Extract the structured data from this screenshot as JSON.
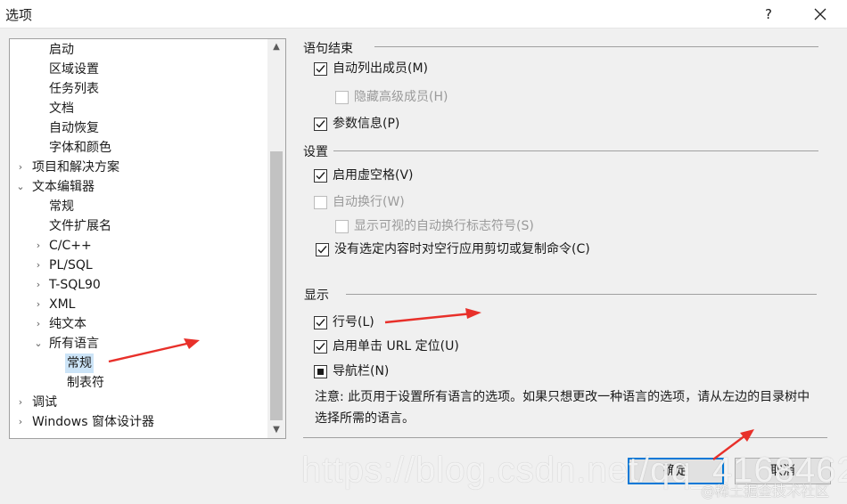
{
  "window": {
    "title": "选项",
    "help_label": "?"
  },
  "tree": {
    "items": [
      {
        "label": "启动",
        "expander": ""
      },
      {
        "label": "区域设置",
        "expander": ""
      },
      {
        "label": "任务列表",
        "expander": ""
      },
      {
        "label": "文档",
        "expander": ""
      },
      {
        "label": "自动恢复",
        "expander": ""
      },
      {
        "label": "字体和颜色",
        "expander": ""
      },
      {
        "label": "项目和解决方案",
        "expander": "›"
      },
      {
        "label": "文本编辑器",
        "expander": "⌄"
      },
      {
        "label": "常规",
        "expander": ""
      },
      {
        "label": "文件扩展名",
        "expander": ""
      },
      {
        "label": "C/C++",
        "expander": "›"
      },
      {
        "label": "PL/SQL",
        "expander": "›"
      },
      {
        "label": "T-SQL90",
        "expander": "›"
      },
      {
        "label": "XML",
        "expander": "›"
      },
      {
        "label": "纯文本",
        "expander": "›"
      },
      {
        "label": "所有语言",
        "expander": "⌄"
      },
      {
        "label": "常规",
        "expander": "",
        "selected": true
      },
      {
        "label": "制表符",
        "expander": ""
      },
      {
        "label": "调试",
        "expander": "›"
      },
      {
        "label": "Windows 窗体设计器",
        "expander": "›"
      }
    ]
  },
  "sections": {
    "statement_completion": {
      "header": "语句结束",
      "auto_list_members": {
        "label": "自动列出成员(M)",
        "checked": true
      },
      "hide_advanced": {
        "label": "隐藏高级成员(H)",
        "checked": false,
        "enabled": false
      },
      "parameter_info": {
        "label": "参数信息(P)",
        "checked": true
      }
    },
    "settings": {
      "header": "设置",
      "virtual_space": {
        "label": "启用虚空格(V)",
        "checked": true
      },
      "word_wrap": {
        "label": "自动换行(W)",
        "checked": false,
        "enabled": false
      },
      "wrap_glyphs": {
        "label": "显示可视的自动换行标志符号(S)",
        "checked": false,
        "enabled": false
      },
      "cut_copy_blank": {
        "label": "没有选定内容时对空行应用剪切或复制命令(C)",
        "checked": true
      }
    },
    "display": {
      "header": "显示",
      "line_numbers": {
        "label": "行号(L)",
        "checked": true
      },
      "url_navigation": {
        "label": "启用单击 URL 定位(U)",
        "checked": true
      },
      "navigation_bar": {
        "label": "导航栏(N)",
        "state": "indeterminate"
      }
    }
  },
  "note": "注意: 此页用于设置所有语言的选项。如果只想更改一种语言的选项，请从左边的目录树中选择所需的语言。",
  "buttons": {
    "ok": "确定",
    "cancel": "取消"
  },
  "watermark": {
    "url": "https://blog.csdn.net/qq_41684621",
    "community": "@稀土掘金技术社区"
  },
  "colors": {
    "accent": "#0078d7",
    "selection": "#cce4f7",
    "annotation": "#e8302a"
  }
}
